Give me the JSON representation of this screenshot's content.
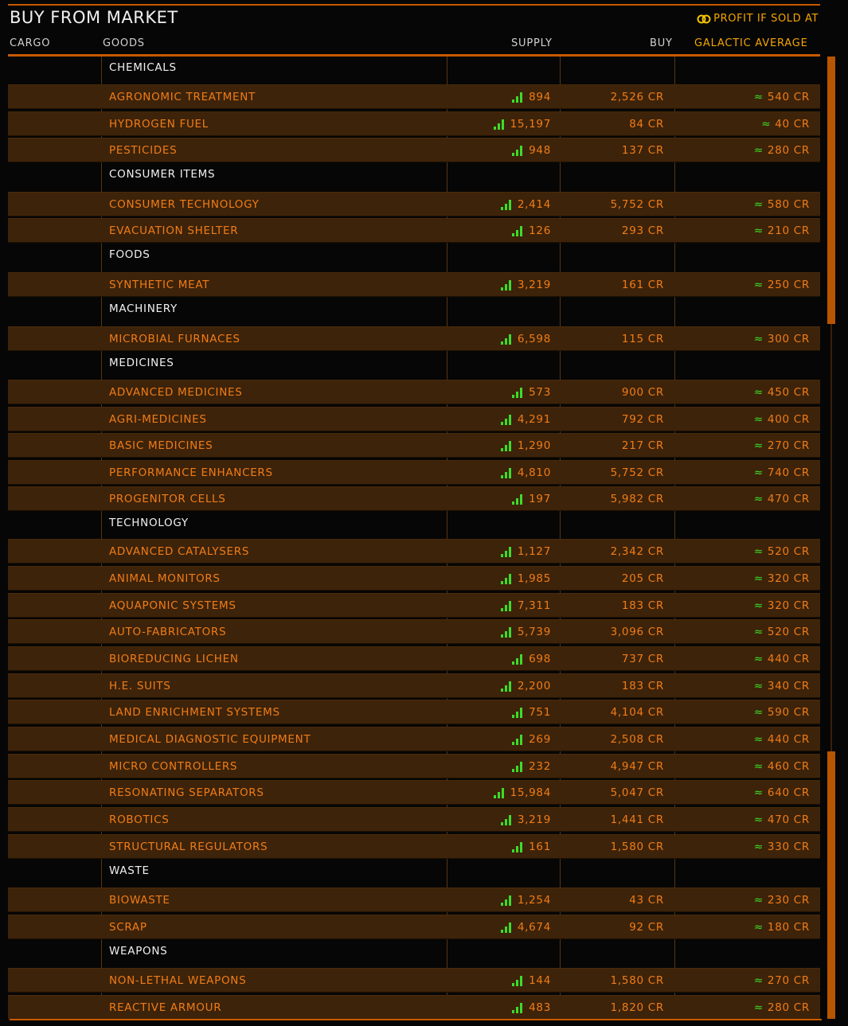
{
  "title": "BUY FROM MARKET",
  "profit_label": "PROFIT IF SOLD AT",
  "columns": {
    "cargo": "CARGO",
    "goods": "GOODS",
    "supply": "SUPPLY",
    "buy": "BUY",
    "galactic_average": "GALACTIC AVERAGE"
  },
  "colors": {
    "accent": "#c85a00",
    "item_text": "#f07c18",
    "supply_bars": "#3ddc2a",
    "row_bg": "#3d2309",
    "header_gold": "#f5a500"
  },
  "rows": [
    {
      "type": "cat",
      "name": "CHEMICALS"
    },
    {
      "type": "item",
      "name": "AGRONOMIC TREATMENT",
      "supply": "894",
      "buy": "2,526 CR",
      "avg": "540 CR"
    },
    {
      "type": "item",
      "name": "HYDROGEN FUEL",
      "supply": "15,197",
      "buy": "84 CR",
      "avg": "40 CR"
    },
    {
      "type": "item",
      "name": "PESTICIDES",
      "supply": "948",
      "buy": "137 CR",
      "avg": "280 CR"
    },
    {
      "type": "cat",
      "name": "CONSUMER ITEMS"
    },
    {
      "type": "item",
      "name": "CONSUMER TECHNOLOGY",
      "supply": "2,414",
      "buy": "5,752 CR",
      "avg": "580 CR"
    },
    {
      "type": "item",
      "name": "EVACUATION SHELTER",
      "supply": "126",
      "buy": "293 CR",
      "avg": "210 CR"
    },
    {
      "type": "cat",
      "name": "FOODS"
    },
    {
      "type": "item",
      "name": "SYNTHETIC MEAT",
      "supply": "3,219",
      "buy": "161 CR",
      "avg": "250 CR"
    },
    {
      "type": "cat",
      "name": "MACHINERY"
    },
    {
      "type": "item",
      "name": "MICROBIAL FURNACES",
      "supply": "6,598",
      "buy": "115 CR",
      "avg": "300 CR"
    },
    {
      "type": "cat",
      "name": "MEDICINES"
    },
    {
      "type": "item",
      "name": "ADVANCED MEDICINES",
      "supply": "573",
      "buy": "900 CR",
      "avg": "450 CR"
    },
    {
      "type": "item",
      "name": "AGRI-MEDICINES",
      "supply": "4,291",
      "buy": "792 CR",
      "avg": "400 CR"
    },
    {
      "type": "item",
      "name": "BASIC MEDICINES",
      "supply": "1,290",
      "buy": "217 CR",
      "avg": "270 CR"
    },
    {
      "type": "item",
      "name": "PERFORMANCE ENHANCERS",
      "supply": "4,810",
      "buy": "5,752 CR",
      "avg": "740 CR"
    },
    {
      "type": "item",
      "name": "PROGENITOR CELLS",
      "supply": "197",
      "buy": "5,982 CR",
      "avg": "470 CR"
    },
    {
      "type": "cat",
      "name": "TECHNOLOGY"
    },
    {
      "type": "item",
      "name": "ADVANCED CATALYSERS",
      "supply": "1,127",
      "buy": "2,342 CR",
      "avg": "520 CR"
    },
    {
      "type": "item",
      "name": "ANIMAL MONITORS",
      "supply": "1,985",
      "buy": "205 CR",
      "avg": "320 CR"
    },
    {
      "type": "item",
      "name": "AQUAPONIC SYSTEMS",
      "supply": "7,311",
      "buy": "183 CR",
      "avg": "320 CR"
    },
    {
      "type": "item",
      "name": "AUTO-FABRICATORS",
      "supply": "5,739",
      "buy": "3,096 CR",
      "avg": "520 CR"
    },
    {
      "type": "item",
      "name": "BIOREDUCING LICHEN",
      "supply": "698",
      "buy": "737 CR",
      "avg": "440 CR"
    },
    {
      "type": "item",
      "name": "H.E. SUITS",
      "supply": "2,200",
      "buy": "183 CR",
      "avg": "340 CR"
    },
    {
      "type": "item",
      "name": "LAND ENRICHMENT SYSTEMS",
      "supply": "751",
      "buy": "4,104 CR",
      "avg": "590 CR"
    },
    {
      "type": "item",
      "name": "MEDICAL DIAGNOSTIC EQUIPMENT",
      "supply": "269",
      "buy": "2,508 CR",
      "avg": "440 CR"
    },
    {
      "type": "item",
      "name": "MICRO CONTROLLERS",
      "supply": "232",
      "buy": "4,947 CR",
      "avg": "460 CR"
    },
    {
      "type": "item",
      "name": "RESONATING SEPARATORS",
      "supply": "15,984",
      "buy": "5,047 CR",
      "avg": "640 CR"
    },
    {
      "type": "item",
      "name": "ROBOTICS",
      "supply": "3,219",
      "buy": "1,441 CR",
      "avg": "470 CR"
    },
    {
      "type": "item",
      "name": "STRUCTURAL REGULATORS",
      "supply": "161",
      "buy": "1,580 CR",
      "avg": "330 CR"
    },
    {
      "type": "cat",
      "name": "WASTE"
    },
    {
      "type": "item",
      "name": "BIOWASTE",
      "supply": "1,254",
      "buy": "43 CR",
      "avg": "230 CR"
    },
    {
      "type": "item",
      "name": "SCRAP",
      "supply": "4,674",
      "buy": "92 CR",
      "avg": "180 CR"
    },
    {
      "type": "cat",
      "name": "WEAPONS"
    },
    {
      "type": "item",
      "name": "NON-LETHAL WEAPONS",
      "supply": "144",
      "buy": "1,580 CR",
      "avg": "270 CR"
    },
    {
      "type": "item",
      "name": "REACTIVE ARMOUR",
      "supply": "483",
      "buy": "1,820 CR",
      "avg": "280 CR"
    }
  ]
}
